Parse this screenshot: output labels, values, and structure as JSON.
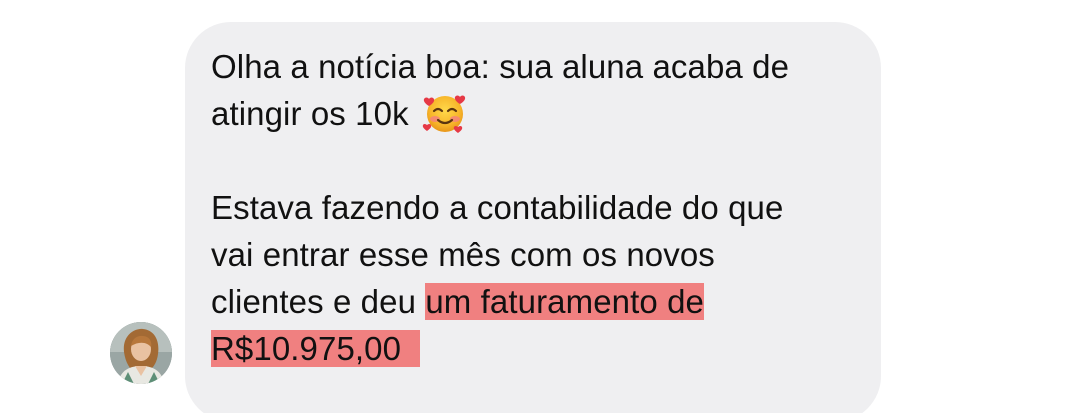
{
  "message": {
    "para1": {
      "line1": "Olha a notícia boa: sua aluna acaba de",
      "line2": "atingir os 10k"
    },
    "para2": {
      "line1": "Estava fazendo a contabilidade do que",
      "line2": "vai entrar esse mês com os novos",
      "line3_plain": "clientes e deu ",
      "line3_highlight": "um faturamento de",
      "line4_highlight": "R$10.975,00"
    },
    "emoji": "smiling-face-with-hearts-icon"
  },
  "colors": {
    "bubble": "#efeff1",
    "highlight": "#f08080",
    "text": "#111111"
  }
}
